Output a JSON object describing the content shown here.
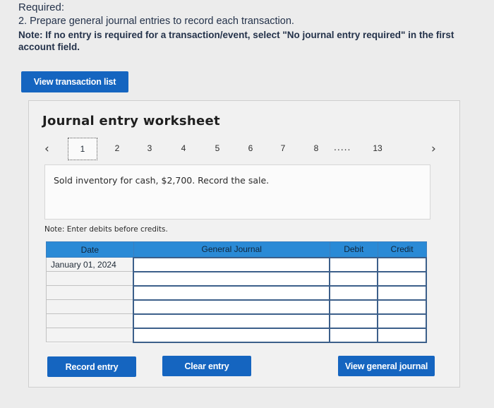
{
  "required": {
    "title": "Required:",
    "instruction": "2. Prepare general journal entries to record each transaction.",
    "note": "Note: If no entry is required for a transaction/event, select \"No journal entry required\" in the first account field."
  },
  "view_transaction_list": "View transaction list",
  "worksheet": {
    "title": "Journal entry worksheet",
    "pager": {
      "prev_icon": "chevron-left-icon",
      "next_icon": "chevron-right-icon",
      "active": "1",
      "pages": [
        "2",
        "3",
        "4",
        "5",
        "6",
        "7",
        "8"
      ],
      "ellipsis": ".....",
      "last": "13"
    },
    "transaction_description": "Sold inventory for cash, $2,700. Record the sale.",
    "entry_note": "Note: Enter debits before credits.",
    "table": {
      "headers": {
        "date": "Date",
        "general_journal": "General Journal",
        "debit": "Debit",
        "credit": "Credit"
      },
      "rows": [
        {
          "date": "January 01, 2024",
          "account": "",
          "debit": "",
          "credit": ""
        },
        {
          "date": "",
          "account": "",
          "debit": "",
          "credit": ""
        },
        {
          "date": "",
          "account": "",
          "debit": "",
          "credit": ""
        },
        {
          "date": "",
          "account": "",
          "debit": "",
          "credit": ""
        },
        {
          "date": "",
          "account": "",
          "debit": "",
          "credit": ""
        },
        {
          "date": "",
          "account": "",
          "debit": "",
          "credit": ""
        }
      ]
    },
    "buttons": {
      "record_entry": "Record entry",
      "clear_entry": "Clear entry",
      "view_general_journal": "View general journal"
    }
  },
  "colors": {
    "primary_button": "#1565c0",
    "table_header": "#2a8ad6",
    "background": "#ececec"
  }
}
